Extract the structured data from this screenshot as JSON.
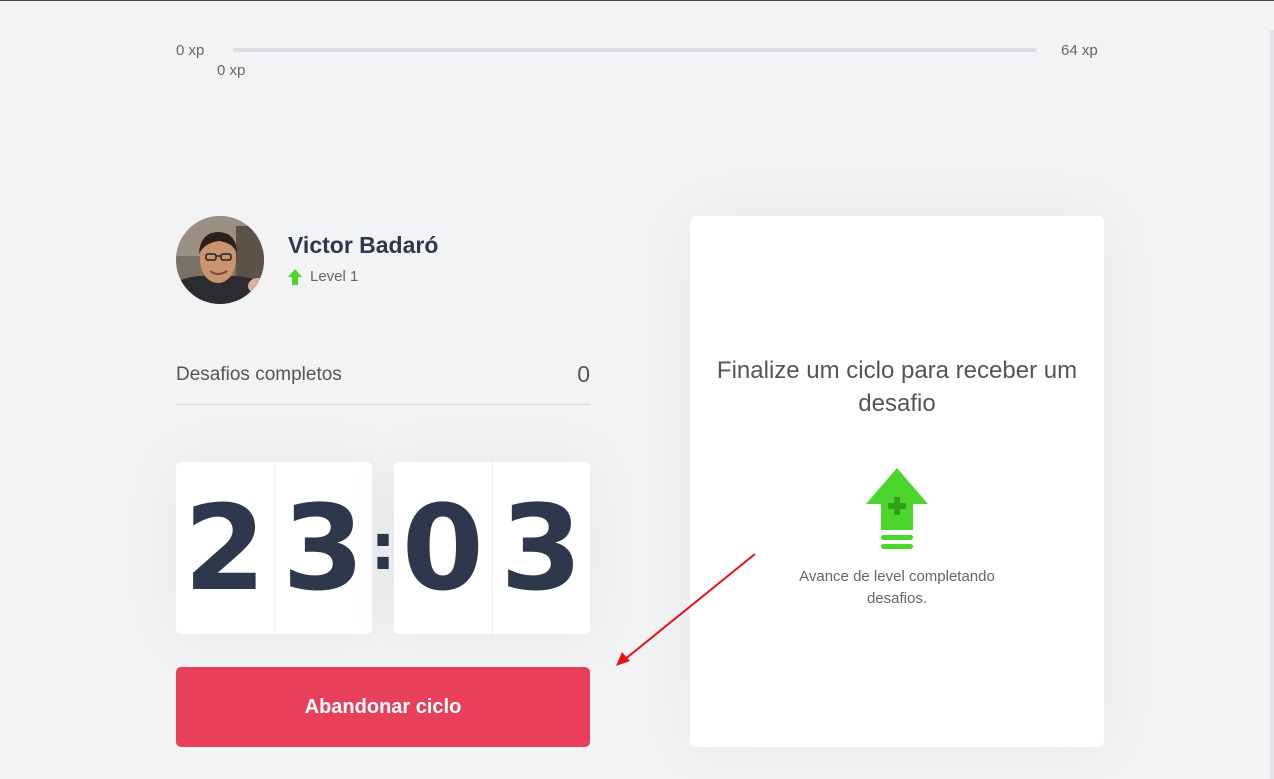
{
  "xp_bar": {
    "min_label": "0 xp",
    "max_label": "64 xp",
    "current_label": "0 xp",
    "progress_fraction": 0
  },
  "profile": {
    "name": "Victor Badaró",
    "level_label": "Level 1"
  },
  "challenges_completed": {
    "label": "Desafios completos",
    "count": "0"
  },
  "countdown": {
    "minute_left": "2",
    "minute_right": "3",
    "separator": ":",
    "second_left": "0",
    "second_right": "3"
  },
  "actions": {
    "abandon_label": "Abandonar ciclo"
  },
  "challenge_box": {
    "title": "Finalize um ciclo para receber um desafio",
    "description": "Avance de level completando desafios.",
    "icon": "level-up-icon"
  },
  "colors": {
    "background": "#f2f3f5",
    "green": "#4cd62b",
    "red": "#e83f5b",
    "title": "#2e384d",
    "annotation": "#e8101a"
  }
}
